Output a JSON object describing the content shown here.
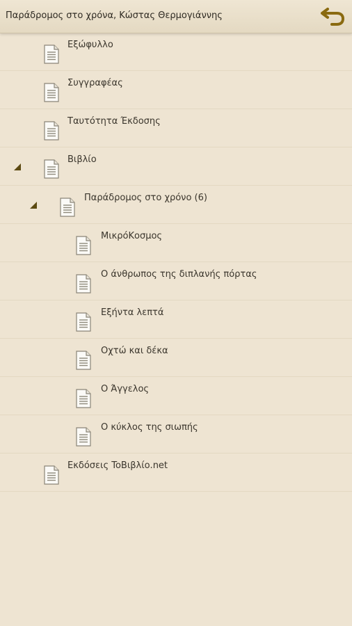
{
  "header": {
    "title": "Παράδρομος στο χρόνα, Κώστας Θερμογιάννης",
    "back_icon": "undo-arrow-icon",
    "accent": "#8a6a10"
  },
  "toc": {
    "items": [
      {
        "label": "Εξώφυλλο"
      },
      {
        "label": "Συγγραφέας"
      },
      {
        "label": "Ταυτότητα Έκδοσης"
      },
      {
        "label": "Βιβλίο",
        "expanded": true
      },
      {
        "label": "Παράδρομος στο χρόνο (6)",
        "expanded": true
      },
      {
        "label": "ΜικρόΚοσμος"
      },
      {
        "label": "Ο άνθρωπος της διπλανής πόρτας"
      },
      {
        "label": "Εξήντα λεπτά"
      },
      {
        "label": "Οχτώ και δέκα"
      },
      {
        "label": "Ο Άγγελος"
      },
      {
        "label": "Ο κύκλος της σιωπής"
      },
      {
        "label": "Εκδόσεις ToΒιβλίο.net"
      }
    ]
  }
}
